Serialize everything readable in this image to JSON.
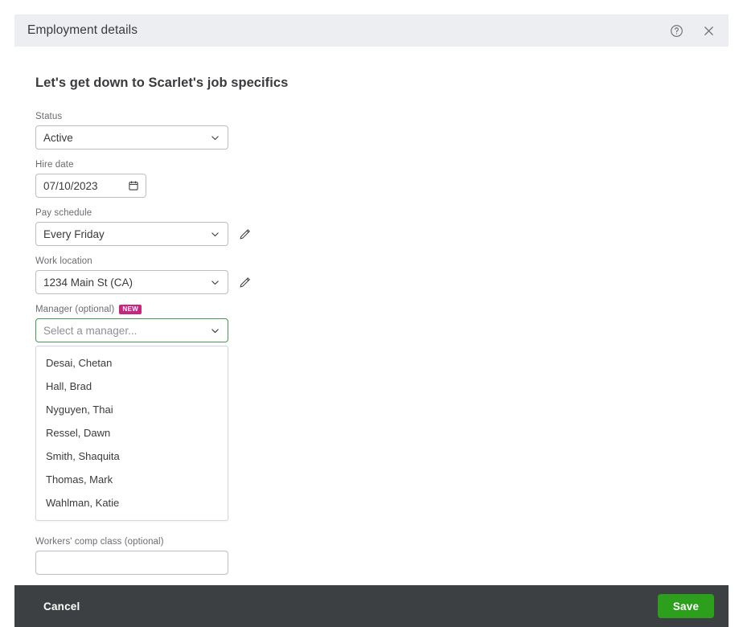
{
  "header": {
    "title": "Employment details",
    "help_icon": "help-circle-icon",
    "close_icon": "close-icon"
  },
  "main": {
    "heading": "Let's get down to Scarlet's job specifics",
    "fields": {
      "status": {
        "label": "Status",
        "value": "Active",
        "control": "select"
      },
      "hire_date": {
        "label": "Hire date",
        "value": "07/10/2023",
        "control": "date",
        "icon": "calendar-icon"
      },
      "pay_schedule": {
        "label": "Pay schedule",
        "value": "Every Friday",
        "control": "select",
        "edit_icon": "pencil-icon"
      },
      "work_location": {
        "label": "Work location",
        "value": "1234 Main St (CA)",
        "control": "select",
        "edit_icon": "pencil-icon"
      },
      "manager": {
        "label": "Manager (optional)",
        "badge": "NEW",
        "placeholder": "Select a manager...",
        "value": "",
        "control": "select",
        "expanded": true,
        "options": [
          "Desai, Chetan",
          "Hall, Brad",
          "Nyguyen, Thai",
          "Ressel, Dawn",
          "Smith, Shaquita",
          "Thomas, Mark",
          "Wahlman, Katie"
        ]
      },
      "workers_comp": {
        "label": "Workers' comp class (optional)",
        "value": "",
        "control": "text"
      }
    }
  },
  "footer": {
    "cancel_label": "Cancel",
    "save_label": "Save"
  },
  "colors": {
    "header_bg": "#eceef1",
    "footer_bg": "#3d4042",
    "save_green": "#2ca01c",
    "focus_green": "#469a4f",
    "badge_magenta": "#c9257f",
    "label_gray": "#6b6c72",
    "text_dark": "#393a3d"
  }
}
